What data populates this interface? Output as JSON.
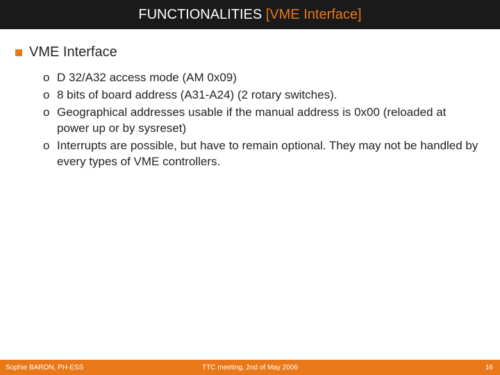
{
  "header": {
    "prefix": "FUNCTIONALITIES ",
    "suffix": "[VME Interface]"
  },
  "section": {
    "heading": "VME Interface",
    "marker": "o",
    "items": [
      "D 32/A32 access mode (AM 0x09)",
      "8 bits of board address (A31-A24) (2 rotary switches).",
      "Geographical addresses usable if the manual address is 0x00 (reloaded at power up or by sysreset)",
      "Interrupts are possible, but have to remain optional. They may not be handled by every types of VME controllers."
    ]
  },
  "footer": {
    "left": "Sophie BARON, PH-ESS",
    "center": "TTC meeting, 2nd of May 2006",
    "page": "16"
  }
}
